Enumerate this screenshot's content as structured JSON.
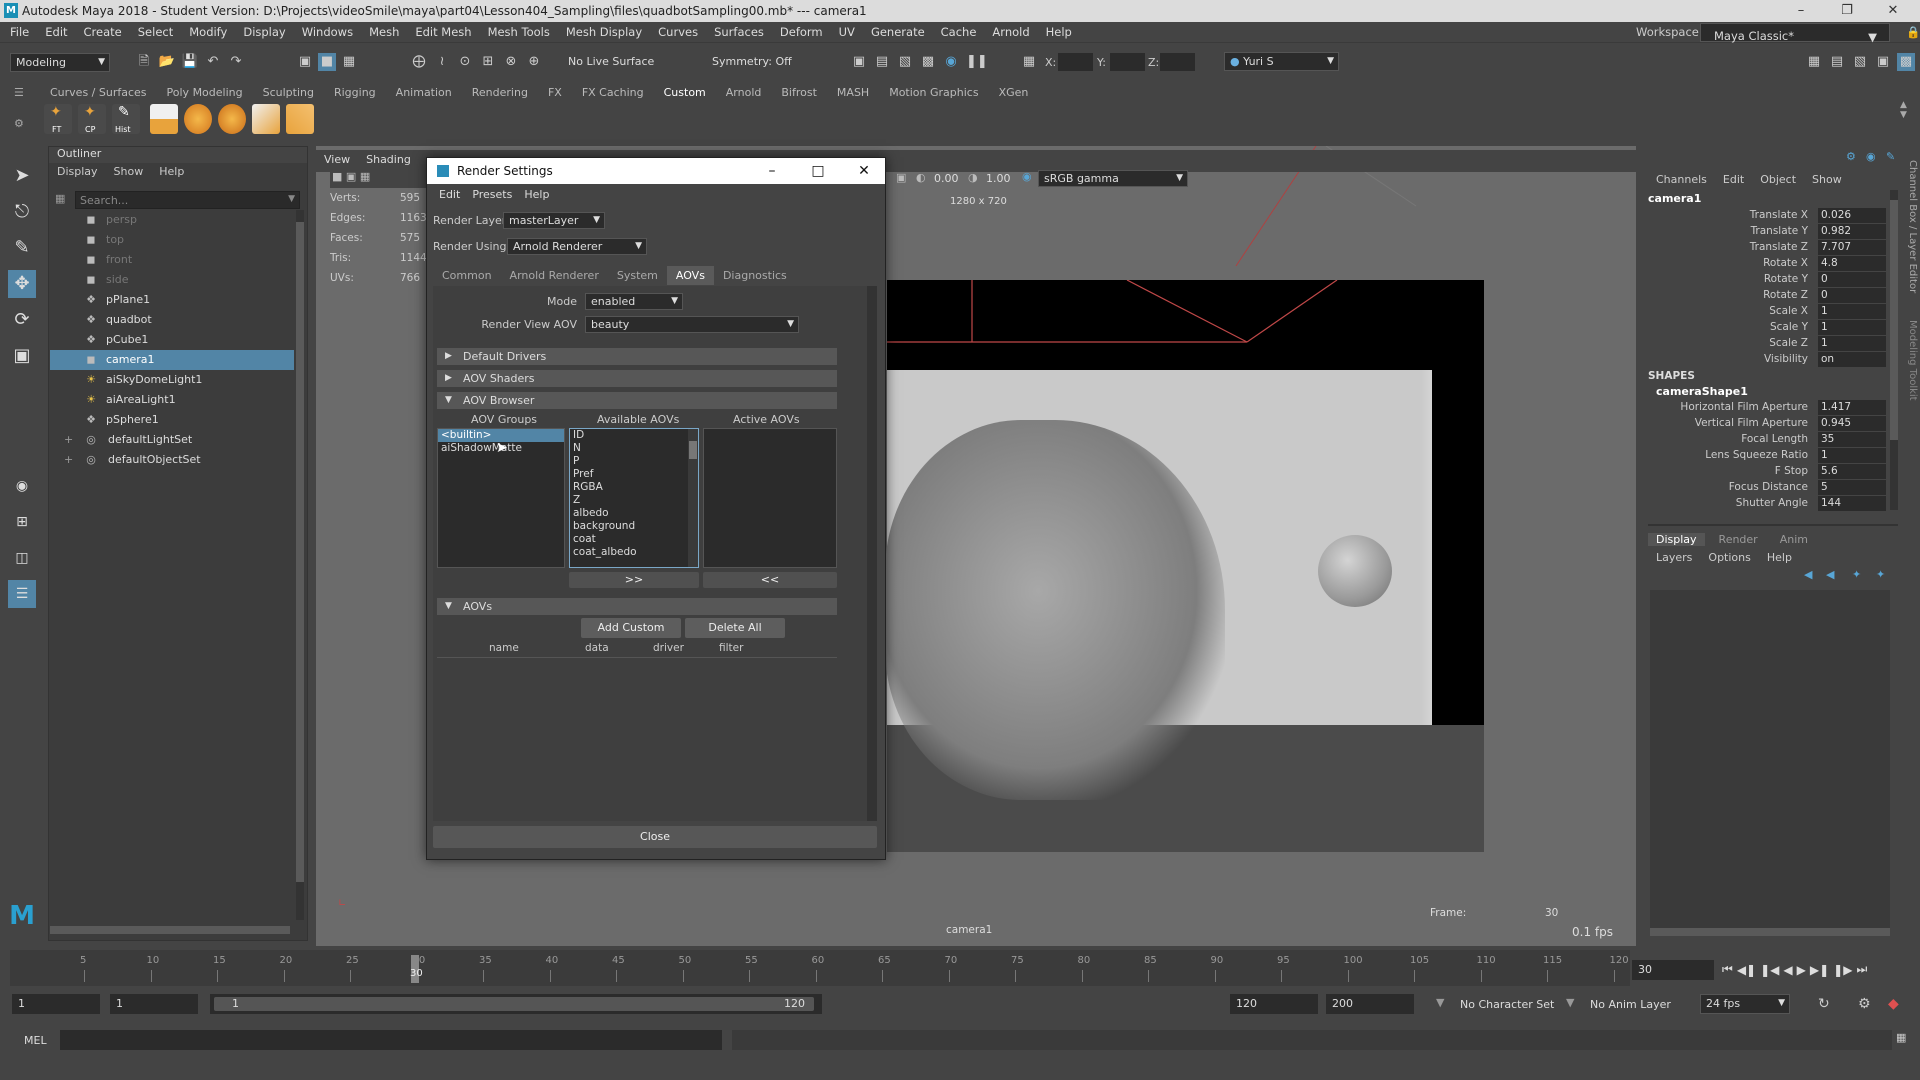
{
  "title_bar": {
    "text": "Autodesk Maya 2018 - Student Version: D:\\Projects\\videoSmile\\maya\\part04\\Lesson404_Sampling\\files\\quadbotSampling00.mb*  ---  camera1"
  },
  "menubar": [
    "File",
    "Edit",
    "Create",
    "Select",
    "Modify",
    "Display",
    "Windows",
    "Mesh",
    "Edit Mesh",
    "Mesh Tools",
    "Mesh Display",
    "Curves",
    "Surfaces",
    "Deform",
    "UV",
    "Generate",
    "Cache",
    "Arnold",
    "Help"
  ],
  "status_line": {
    "mode": "Modeling",
    "live_surface": "No Live Surface",
    "symmetry": "Symmetry: Off",
    "x_label": "X:",
    "y_label": "Y:",
    "z_label": "Z:",
    "user": "Yuri S",
    "workspace_label": "Workspace :",
    "workspace": "Maya Classic*"
  },
  "shelf_tabs": [
    "Curves / Surfaces",
    "Poly Modeling",
    "Sculpting",
    "Rigging",
    "Animation",
    "Rendering",
    "FX",
    "FX Caching",
    "Custom",
    "Arnold",
    "Bifrost",
    "MASH",
    "Motion Graphics",
    "XGen"
  ],
  "shelf_active": "Custom",
  "shelf_labels": [
    "FT",
    "CP",
    "Hist"
  ],
  "outliner": {
    "title": "Outliner",
    "menus": [
      "Display",
      "Show",
      "Help"
    ],
    "search_placeholder": "Search...",
    "items": [
      {
        "label": "persp",
        "icon": "camera-icon",
        "dim": true
      },
      {
        "label": "top",
        "icon": "camera-icon",
        "dim": true
      },
      {
        "label": "front",
        "icon": "camera-icon",
        "dim": true
      },
      {
        "label": "side",
        "icon": "camera-icon",
        "dim": true
      },
      {
        "label": "pPlane1",
        "icon": "mesh-icon"
      },
      {
        "label": "quadbot",
        "icon": "mesh-icon"
      },
      {
        "label": "pCube1",
        "icon": "mesh-icon"
      },
      {
        "label": "camera1",
        "icon": "camera-icon",
        "selected": true
      },
      {
        "label": "aiSkyDomeLight1",
        "icon": "light-icon"
      },
      {
        "label": "aiAreaLight1",
        "icon": "light-icon"
      },
      {
        "label": "pSphere1",
        "icon": "mesh-icon"
      },
      {
        "label": "defaultLightSet",
        "icon": "set-icon"
      },
      {
        "label": "defaultObjectSet",
        "icon": "set-icon"
      }
    ]
  },
  "viewport": {
    "menus": [
      "View",
      "Shading"
    ],
    "hud": [
      {
        "label": "Verts:",
        "value": "595"
      },
      {
        "label": "Edges:",
        "value": "1163"
      },
      {
        "label": "Faces:",
        "value": "575"
      },
      {
        "label": "Tris:",
        "value": "1144"
      },
      {
        "label": "UVs:",
        "value": "766"
      }
    ],
    "resolution": "1280 x 720",
    "exposure": "0.00",
    "gamma": "1.00",
    "color_space": "sRGB gamma",
    "camera_name": "camera1",
    "frame_label": "Frame:",
    "frame_value": "30",
    "fps": "0.1 fps"
  },
  "render_settings": {
    "title": "Render Settings",
    "menus": [
      "Edit",
      "Presets",
      "Help"
    ],
    "render_layer_label": "Render Layer",
    "render_layer": "masterLayer",
    "render_using_label": "Render Using",
    "render_using": "Arnold Renderer",
    "tabs": [
      "Common",
      "Arnold Renderer",
      "System",
      "AOVs",
      "Diagnostics"
    ],
    "active_tab": "AOVs",
    "mode_label": "Mode",
    "mode": "enabled",
    "render_view_aov_label": "Render View AOV",
    "render_view_aov": "beauty",
    "frames": [
      "Default Drivers",
      "AOV Shaders",
      "AOV Browser"
    ],
    "col_groups": "AOV Groups",
    "col_available": "Available AOVs",
    "col_active": "Active AOVs",
    "aov_groups": [
      "<builtin>",
      "aiShadowMatte"
    ],
    "available_aovs": [
      "ID",
      "N",
      "P",
      "Pref",
      "RGBA",
      "Z",
      "albedo",
      "background",
      "coat",
      "coat_albedo"
    ],
    "add_arrow": ">>",
    "remove_arrow": "<<",
    "aovs_frame": "AOVs",
    "add_custom": "Add Custom",
    "delete_all": "Delete All",
    "table_headers": [
      "name",
      "data",
      "driver",
      "filter"
    ],
    "close": "Close"
  },
  "channel_box": {
    "menus": [
      "Channels",
      "Edit",
      "Object",
      "Show"
    ],
    "object": "camera1",
    "channels": [
      {
        "label": "Translate X",
        "value": "0.026"
      },
      {
        "label": "Translate Y",
        "value": "0.982"
      },
      {
        "label": "Translate Z",
        "value": "7.707"
      },
      {
        "label": "Rotate X",
        "value": "4.8"
      },
      {
        "label": "Rotate Y",
        "value": "0"
      },
      {
        "label": "Rotate Z",
        "value": "0"
      },
      {
        "label": "Scale X",
        "value": "1"
      },
      {
        "label": "Scale Y",
        "value": "1"
      },
      {
        "label": "Scale Z",
        "value": "1"
      },
      {
        "label": "Visibility",
        "value": "on"
      }
    ],
    "shapes_label": "SHAPES",
    "shape_name": "cameraShape1",
    "shape_channels": [
      {
        "label": "Horizontal Film Aperture",
        "value": "1.417"
      },
      {
        "label": "Vertical Film Aperture",
        "value": "0.945"
      },
      {
        "label": "Focal Length",
        "value": "35"
      },
      {
        "label": "Lens Squeeze Ratio",
        "value": "1"
      },
      {
        "label": "F Stop",
        "value": "5.6"
      },
      {
        "label": "Focus Distance",
        "value": "5"
      },
      {
        "label": "Shutter Angle",
        "value": "144"
      }
    ],
    "layer_tabs": [
      "Display",
      "Render",
      "Anim"
    ],
    "layer_menus": [
      "Layers",
      "Options",
      "Help"
    ],
    "side_tabs": [
      "Channel Box / Layer Editor",
      "Modeling Toolkit"
    ]
  },
  "time_slider": {
    "ticks": [
      "5",
      "10",
      "15",
      "20",
      "25",
      "30",
      "35",
      "40",
      "45",
      "50",
      "55",
      "60",
      "65",
      "70",
      "75",
      "80",
      "85",
      "90",
      "95",
      "100",
      "105",
      "110",
      "115",
      "120"
    ],
    "current_frame": "30",
    "current_field": "30"
  },
  "range": {
    "start": "1",
    "anim_start": "1",
    "slider_start": "1",
    "slider_end": "120",
    "end": "120",
    "anim_end": "200",
    "char_set": "No Character Set",
    "anim_layer": "No Anim Layer",
    "fps": "24 fps"
  },
  "command_line": {
    "label": "MEL"
  }
}
